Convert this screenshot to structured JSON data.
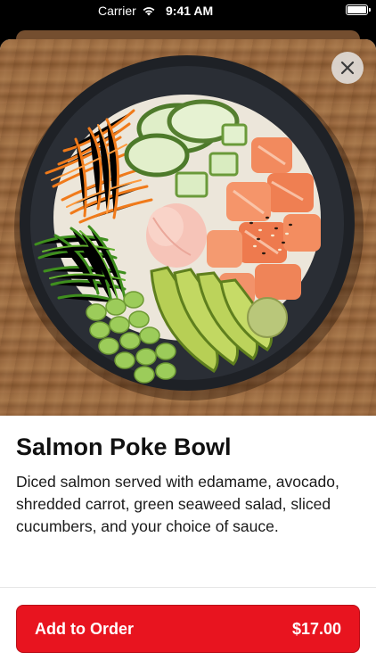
{
  "status_bar": {
    "carrier": "Carrier",
    "time": "9:41 AM",
    "wifi_icon": "wifi-icon",
    "battery_icon": "battery-icon"
  },
  "item": {
    "title": "Salmon Poke Bowl",
    "description": "Diced salmon served with edamame, avocado, shredded carrot, green seaweed salad, sliced cucumbers, and your choice of sauce.",
    "image_icon": "poke-bowl-image"
  },
  "close": {
    "icon": "close-icon"
  },
  "order_button": {
    "label": "Add to Order",
    "price": "$17.00",
    "color": "#e8141f"
  }
}
